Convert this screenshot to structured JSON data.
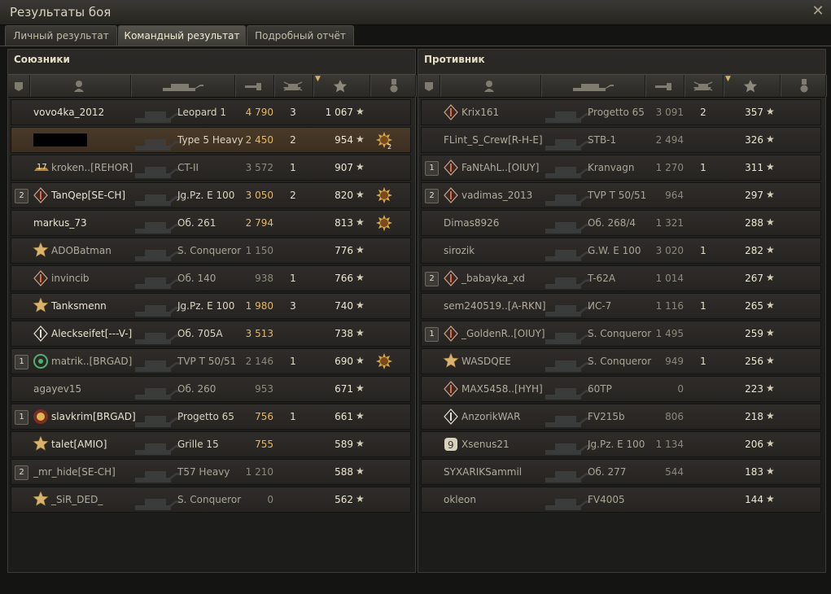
{
  "window": {
    "title": "Результаты боя",
    "close_icon": "close-icon"
  },
  "tabs": [
    {
      "label": "Личный результат",
      "active": false
    },
    {
      "label": "Командный результат",
      "active": true
    },
    {
      "label": "Подробный отчёт",
      "active": false
    }
  ],
  "allies": {
    "title": "Союзники",
    "rows": [
      {
        "rank": "",
        "badge": "",
        "name": "vovo4ka_2012",
        "alive": true,
        "tank": "Leopard 1",
        "damage": "4 790",
        "damage_color": "gold",
        "kills": "3",
        "xp": "1 067",
        "medal": ""
      },
      {
        "rank": "",
        "badge": "",
        "name": "",
        "redacted": true,
        "me": true,
        "alive": true,
        "tank": "Type 5 Heavy",
        "damage": "2 450",
        "damage_color": "gold",
        "kills": "2",
        "xp": "954",
        "medal": "sun-medal-2"
      },
      {
        "rank": "",
        "badge": "badge-17",
        "name": "kroken..[REHOR]",
        "alive": false,
        "tank": "CT-II",
        "damage": "3 572",
        "damage_color": "grey",
        "kills": "1",
        "xp": "907",
        "medal": ""
      },
      {
        "rank": "2",
        "badge": "diamond",
        "name": "TanQep[SE-CH]",
        "alive": true,
        "tank": "Jg.Pz. E 100",
        "damage": "3 050",
        "damage_color": "gold",
        "kills": "2",
        "xp": "820",
        "medal": "sun-medal"
      },
      {
        "rank": "",
        "badge": "",
        "name": "markus_73",
        "alive": true,
        "tank": "Об. 261",
        "damage": "2 794",
        "damage_color": "gold",
        "kills": "",
        "xp": "813",
        "medal": "sun-medal"
      },
      {
        "rank": "",
        "badge": "star-gold",
        "name": "ADOBatman",
        "alive": false,
        "tank": "S. Conqueror",
        "damage": "1 150",
        "damage_color": "grey",
        "kills": "",
        "xp": "776",
        "medal": ""
      },
      {
        "rank": "",
        "badge": "diamond",
        "name": "invincib",
        "alive": false,
        "tank": "Об. 140",
        "damage": "938",
        "damage_color": "grey",
        "kills": "1",
        "xp": "766",
        "medal": ""
      },
      {
        "rank": "",
        "badge": "star-gold",
        "name": "Tanksmenn",
        "alive": true,
        "tank": "Jg.Pz. E 100",
        "damage": "1 980",
        "damage_color": "gold",
        "kills": "3",
        "xp": "740",
        "medal": ""
      },
      {
        "rank": "",
        "badge": "diamond-white",
        "name": "Aleckseifet[---V-]",
        "alive": true,
        "tank": "Об. 705А",
        "damage": "3 513",
        "damage_color": "gold",
        "kills": "",
        "xp": "738",
        "medal": ""
      },
      {
        "rank": "1",
        "badge": "emblem-green",
        "name": "matrik..[BRGAD]",
        "alive": false,
        "tank": "TVP T 50/51",
        "damage": "2 146",
        "damage_color": "grey",
        "kills": "1",
        "xp": "690",
        "medal": "sun-medal"
      },
      {
        "rank": "",
        "badge": "",
        "name": "agayev15",
        "alive": false,
        "tank": "Об. 260",
        "damage": "953",
        "damage_color": "grey",
        "kills": "",
        "xp": "671",
        "medal": ""
      },
      {
        "rank": "1",
        "badge": "clan-emblem",
        "name": "slavkrim[BRGAD]",
        "alive": true,
        "tank": "Progetto 65",
        "damage": "756",
        "damage_color": "gold",
        "kills": "1",
        "xp": "661",
        "medal": ""
      },
      {
        "rank": "",
        "badge": "star-gold",
        "name": "talet[AMIO]",
        "alive": true,
        "tank": "Grille 15",
        "damage": "755",
        "damage_color": "gold",
        "kills": "",
        "xp": "589",
        "medal": ""
      },
      {
        "rank": "2",
        "badge": "",
        "name": "_mr_hide[SE-CH]",
        "alive": false,
        "tank": "T57 Heavy",
        "damage": "1 210",
        "damage_color": "grey",
        "kills": "",
        "xp": "588",
        "medal": ""
      },
      {
        "rank": "",
        "badge": "star-gold",
        "name": "_SiR_DED_",
        "alive": false,
        "tank": "S. Conqueror",
        "damage": "0",
        "damage_color": "grey",
        "kills": "",
        "xp": "562",
        "medal": ""
      }
    ]
  },
  "enemies": {
    "title": "Противник",
    "rows": [
      {
        "rank": "",
        "badge": "diamond",
        "name": "Krix161",
        "alive": false,
        "tank": "Progetto 65",
        "damage": "3 091",
        "damage_color": "grey",
        "kills": "2",
        "xp": "357",
        "medal": ""
      },
      {
        "rank": "",
        "badge": "",
        "name": "FLint_S_Crew[R-H-E]",
        "alive": false,
        "tank": "STB-1",
        "damage": "2 494",
        "damage_color": "grey",
        "kills": "",
        "xp": "326",
        "medal": ""
      },
      {
        "rank": "1",
        "badge": "diamond",
        "name": "FaNtAhL..[OIUY]",
        "alive": false,
        "tank": "Kranvagn",
        "damage": "1 270",
        "damage_color": "grey",
        "kills": "1",
        "xp": "311",
        "medal": ""
      },
      {
        "rank": "2",
        "badge": "diamond",
        "name": "vadimas_2013",
        "alive": false,
        "tank": "TVP T 50/51",
        "damage": "964",
        "damage_color": "grey",
        "kills": "",
        "xp": "297",
        "medal": ""
      },
      {
        "rank": "",
        "badge": "",
        "name": "Dimas8926",
        "alive": false,
        "tank": "Об. 268/4",
        "damage": "1 321",
        "damage_color": "grey",
        "kills": "",
        "xp": "288",
        "medal": ""
      },
      {
        "rank": "",
        "badge": "",
        "name": "sirozik",
        "alive": false,
        "tank": "G.W. E 100",
        "damage": "3 020",
        "damage_color": "grey",
        "kills": "1",
        "xp": "282",
        "medal": ""
      },
      {
        "rank": "2",
        "badge": "diamond",
        "name": "_babayka_xd",
        "alive": false,
        "tank": "T-62A",
        "damage": "1 014",
        "damage_color": "grey",
        "kills": "",
        "xp": "267",
        "medal": ""
      },
      {
        "rank": "",
        "badge": "",
        "name": "sem240519..[A-RKN]",
        "alive": false,
        "tank": "ИС-7",
        "damage": "1 116",
        "damage_color": "grey",
        "kills": "1",
        "xp": "265",
        "medal": ""
      },
      {
        "rank": "1",
        "badge": "diamond",
        "name": "_GoldenR..[OIUY]",
        "alive": false,
        "tank": "S. Conqueror",
        "damage": "1 495",
        "damage_color": "grey",
        "kills": "",
        "xp": "259",
        "medal": ""
      },
      {
        "rank": "",
        "badge": "star-gold",
        "name": "WASDQEE",
        "alive": false,
        "tank": "S. Conqueror",
        "damage": "949",
        "damage_color": "grey",
        "kills": "1",
        "xp": "256",
        "medal": ""
      },
      {
        "rank": "",
        "badge": "diamond",
        "name": "MAX5458..[HYH]",
        "alive": false,
        "tank": "60TP",
        "damage": "0",
        "damage_color": "grey",
        "kills": "",
        "xp": "223",
        "medal": ""
      },
      {
        "rank": "",
        "badge": "diamond-white",
        "name": "AnzorikWAR",
        "alive": false,
        "tank": "FV215b",
        "damage": "806",
        "damage_color": "grey",
        "kills": "",
        "xp": "218",
        "medal": ""
      },
      {
        "rank": "",
        "badge": "badge-9",
        "name": "Xsenus21",
        "alive": false,
        "tank": "Jg.Pz. E 100",
        "damage": "1 134",
        "damage_color": "grey",
        "kills": "",
        "xp": "206",
        "medal": ""
      },
      {
        "rank": "",
        "badge": "",
        "name": "SYXARIKSammil",
        "alive": false,
        "tank": "Об. 277",
        "damage": "544",
        "damage_color": "grey",
        "kills": "",
        "xp": "183",
        "medal": ""
      },
      {
        "rank": "",
        "badge": "",
        "name": "okleon",
        "alive": false,
        "tank": "FV4005",
        "damage": "",
        "damage_color": "grey",
        "kills": "",
        "xp": "144",
        "medal": ""
      }
    ]
  },
  "columns": [
    "rank-icon",
    "player-icon",
    "tank-icon",
    "damage-icon",
    "kills-icon",
    "xp-star-icon",
    "medal-icon"
  ],
  "colors": {
    "accent_gold": "#e5b766",
    "text_main": "#ece6d1",
    "text_dim": "#aaa594"
  }
}
